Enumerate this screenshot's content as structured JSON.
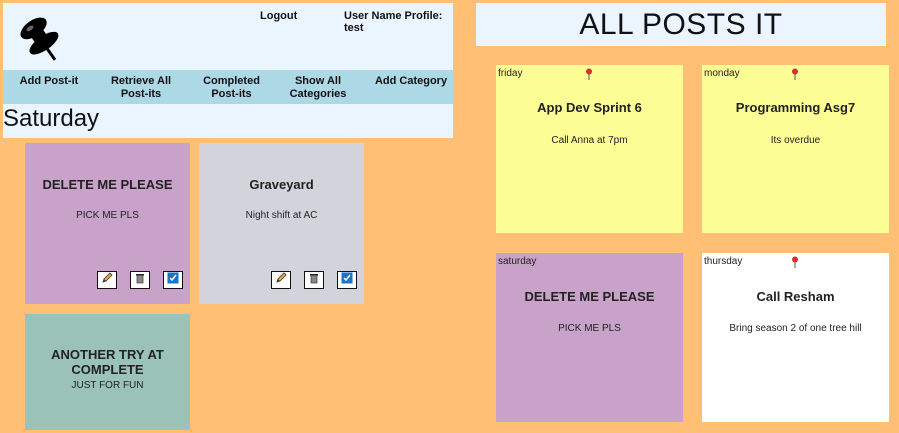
{
  "header": {
    "logout_label": "Logout",
    "user_profile": "User Name Profile: test"
  },
  "nav": {
    "add_postit": "Add Post-it",
    "retrieve_all": "Retrieve All Post-its",
    "completed": "Completed Post-its",
    "show_categories": "Show All Categories",
    "add_category": "Add Category"
  },
  "day_title": "Saturday",
  "left_notes": [
    {
      "title": "DELETE ME PLEASE",
      "body": "PICK ME PLS",
      "color": "#c8a2c8"
    },
    {
      "title": "Graveyard",
      "body": "Night shift at AC",
      "color": "#d3d3dc"
    },
    {
      "title": "ANOTHER TRY AT COMPLETE",
      "body": "JUST FOR FUN",
      "color": "#9ac2b8"
    }
  ],
  "right": {
    "title": "ALL POSTS IT",
    "notes": [
      {
        "day": "friday",
        "title": "App Dev Sprint 6",
        "body": "Call Anna at 7pm",
        "color": "#fdfd96",
        "pinned": true
      },
      {
        "day": "monday",
        "title": "Programming Asg7",
        "body": "Its overdue",
        "color": "#fdfd96",
        "pinned": true
      },
      {
        "day": "saturday",
        "title": "DELETE ME PLEASE",
        "body": "PICK ME PLS",
        "color": "#c8a2c8",
        "pinned": false
      },
      {
        "day": "thursday",
        "title": "Call Resham",
        "body": "Bring season 2 of one tree hill",
        "color": "#ffffff",
        "pinned": true
      }
    ]
  },
  "icons": {
    "edit": "pencil-icon",
    "delete": "trash-icon",
    "complete": "checkbox-icon",
    "pin": "pushpin-icon",
    "logo": "pushpin-logo-icon"
  }
}
